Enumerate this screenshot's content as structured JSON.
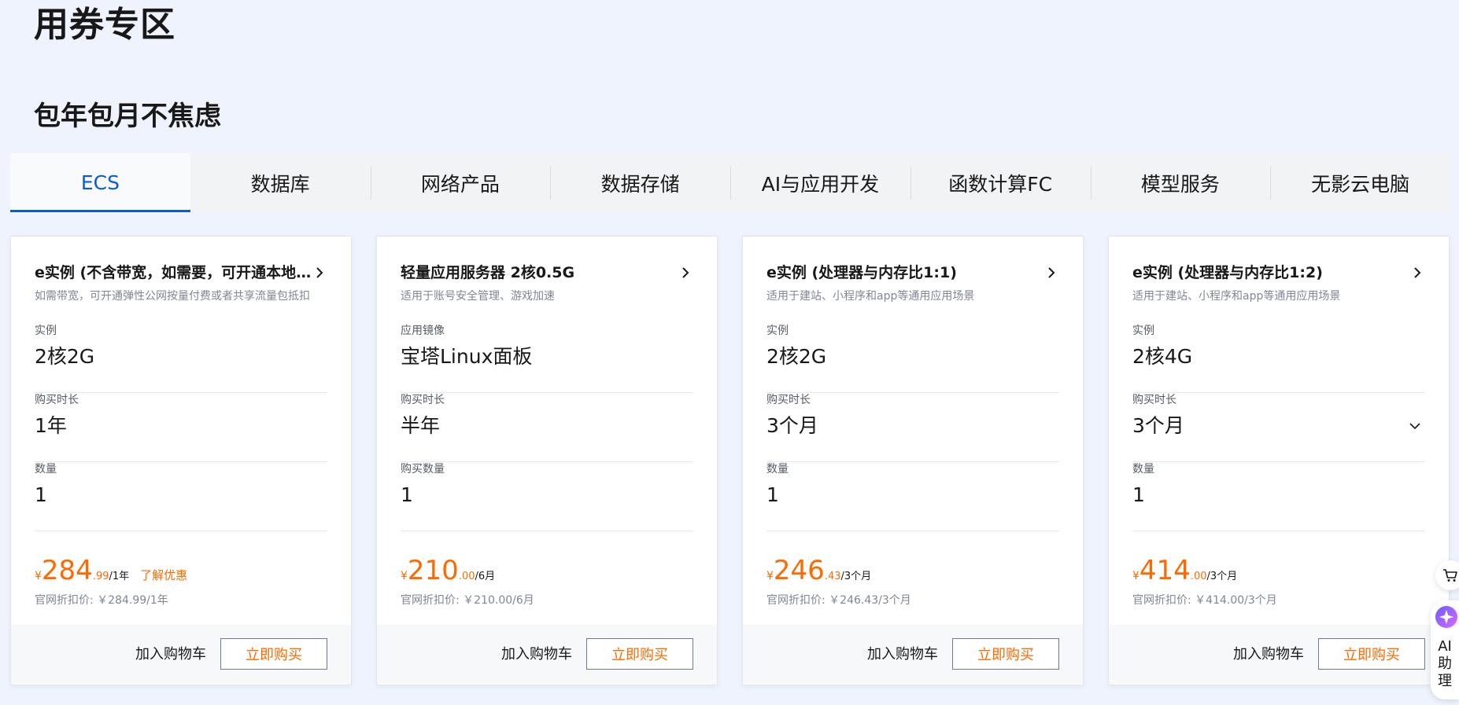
{
  "page_title": "用券专区",
  "section_title": "包年包月不焦虑",
  "tabs": [
    {
      "label": "ECS",
      "active": true
    },
    {
      "label": "数据库"
    },
    {
      "label": "网络产品"
    },
    {
      "label": "数据存储"
    },
    {
      "label": "AI与应用开发"
    },
    {
      "label": "函数计算FC"
    },
    {
      "label": "模型服务"
    },
    {
      "label": "无影云电脑"
    }
  ],
  "cards": [
    {
      "title": "e实例 (不含带宽，如需要，可开通本地带宽)",
      "subtitle": "如需带宽，可开通弹性公网按量付费或者共享流量包抵扣",
      "fields": [
        {
          "label": "实例",
          "value": "2核2G"
        },
        {
          "label": "购买时长",
          "value": "1年"
        },
        {
          "label": "数量",
          "value": "1"
        }
      ],
      "price": {
        "yen": "¥",
        "int": "284",
        "dec": ".99",
        "unit": "/1年"
      },
      "promo_link": "了解优惠",
      "original_price": "官网折扣价: ￥284.99/1年",
      "cart_label": "加入购物车",
      "buy_label": "立即购买"
    },
    {
      "title": "轻量应用服务器 2核0.5G",
      "subtitle": "适用于账号安全管理、游戏加速",
      "fields": [
        {
          "label": "应用镜像",
          "value": "宝塔Linux面板"
        },
        {
          "label": "购买时长",
          "value": "半年"
        },
        {
          "label": "购买数量",
          "value": "1"
        }
      ],
      "price": {
        "yen": "¥",
        "int": "210",
        "dec": ".00",
        "unit": "/6月"
      },
      "original_price": "官网折扣价: ￥210.00/6月",
      "cart_label": "加入购物车",
      "buy_label": "立即购买"
    },
    {
      "title": "e实例 (处理器与内存比1:1)",
      "subtitle": "适用于建站、小程序和app等通用应用场景",
      "fields": [
        {
          "label": "实例",
          "value": "2核2G"
        },
        {
          "label": "购买时长",
          "value": "3个月"
        },
        {
          "label": "数量",
          "value": "1"
        }
      ],
      "price": {
        "yen": "¥",
        "int": "246",
        "dec": ".43",
        "unit": "/3个月"
      },
      "original_price": "官网折扣价: ￥246.43/3个月",
      "cart_label": "加入购物车",
      "buy_label": "立即购买"
    },
    {
      "title": "e实例 (处理器与内存比1:2)",
      "subtitle": "适用于建站、小程序和app等通用应用场景",
      "fields": [
        {
          "label": "实例",
          "value": "2核4G"
        },
        {
          "label": "购买时长",
          "value": "3个月",
          "dropdown": true
        },
        {
          "label": "数量",
          "value": "1"
        }
      ],
      "price": {
        "yen": "¥",
        "int": "414",
        "dec": ".00",
        "unit": "/3个月"
      },
      "original_price": "官网折扣价: ￥414.00/3个月",
      "cart_label": "加入购物车",
      "buy_label": "立即购买"
    }
  ],
  "float_ai": {
    "label": "AI助理"
  },
  "colors": {
    "accent": "#0a5bd6",
    "price": "#ff6a00",
    "bg": "#eff3fd"
  },
  "icons": {
    "arrow": "chevron-right-icon",
    "dropdown": "chevron-down-icon",
    "cart": "cart-icon",
    "ai": "ai-assistant-icon"
  }
}
